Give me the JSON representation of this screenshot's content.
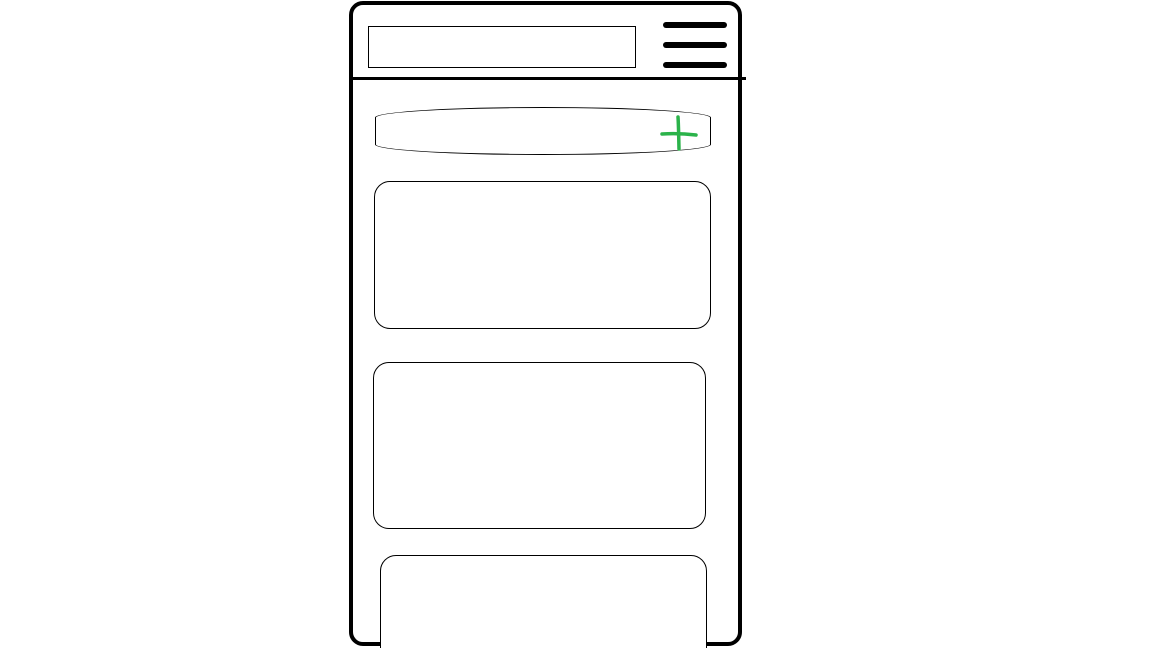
{
  "app": {
    "header": {
      "title_field": "",
      "menu_icon": "hamburger-menu-icon"
    },
    "add_bar": {
      "label": "",
      "icon": "plus-icon",
      "icon_color": "#2bb34a"
    },
    "cards": [
      {
        "content": ""
      },
      {
        "content": ""
      },
      {
        "content": ""
      }
    ],
    "colors": {
      "frame": "#000000",
      "background": "#ffffff",
      "accent": "#2bb34a"
    }
  }
}
